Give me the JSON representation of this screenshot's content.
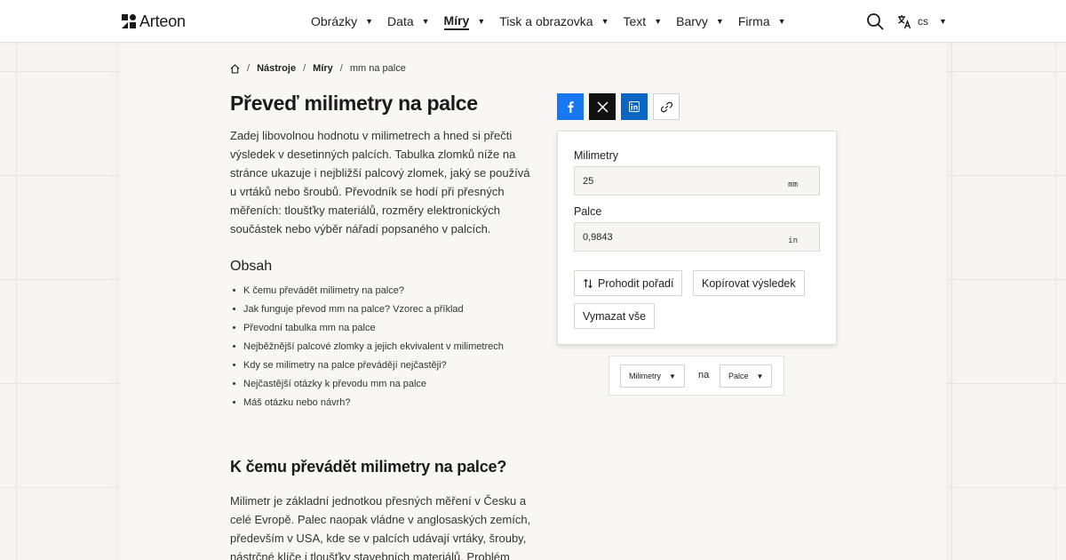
{
  "header": {
    "logo_text": "Arteon",
    "nav": [
      {
        "label": "Obrázky",
        "active": false
      },
      {
        "label": "Data",
        "active": false
      },
      {
        "label": "Míry",
        "active": true
      },
      {
        "label": "Tisk a obrazovka",
        "active": false
      },
      {
        "label": "Text",
        "active": false
      },
      {
        "label": "Barvy",
        "active": false
      },
      {
        "label": "Firma",
        "active": false
      }
    ],
    "language": "cs"
  },
  "breadcrumb": {
    "items": [
      "Nástroje",
      "Míry",
      "mm na palce"
    ],
    "separator": "/"
  },
  "page": {
    "title": "Převeď milimetry na palce",
    "intro": "Zadej libovolnou hodnotu v milimetrech a hned si přečti výsledek v desetinných palcích. Tabulka zlomků níže na stránce ukazuje i nejbližší palcový zlomek, jaký se používá u vrtáků nebo šroubů. Převodník se hodí při přesných měřeních: tloušťky materiálů, rozměry elektronických součástek nebo výběr nářadí popsaného v palcích.",
    "toc_heading": "Obsah",
    "toc": [
      "K čemu převádět milimetry na palce?",
      "Jak funguje převod mm na palce? Vzorec a příklad",
      "Převodní tabulka mm na palce",
      "Nejběžnější palcové zlomky a jejich ekvivalent v milimetrech",
      "Kdy se milimetry na palce převádějí nejčastěji?",
      "Nejčastější otázky k převodu mm na palce",
      "Máš otázku nebo návrh?"
    ],
    "section_title": "K čemu převádět milimetry na palce?",
    "section_text": "Milimetr je základní jednotkou přesných měření v Česku a celé Evropě. Palec naopak vládne v anglosaských zemích, především v USA, kde se v palcích udávají vrtáky, šrouby, nástrčné klíče i tloušťky stavebních materiálů. Problém"
  },
  "share": {
    "icons": [
      "facebook-icon",
      "x-icon",
      "linkedin-icon",
      "link-icon"
    ],
    "colors": {
      "facebook": "#1877f2",
      "x": "#111111",
      "linkedin": "#0a66c2"
    }
  },
  "converter": {
    "mm_label": "Milimetry",
    "mm_value": "25",
    "mm_unit": "mm",
    "in_label": "Palce",
    "in_value": "0,9843",
    "in_unit": "in",
    "swap_label": "Prohodit pořadí",
    "copy_label": "Kopírovat výsledek",
    "clear_label": "Vymazat vše"
  },
  "unit_selector": {
    "from": "Milimetry",
    "connector": "na",
    "to": "Palce"
  }
}
